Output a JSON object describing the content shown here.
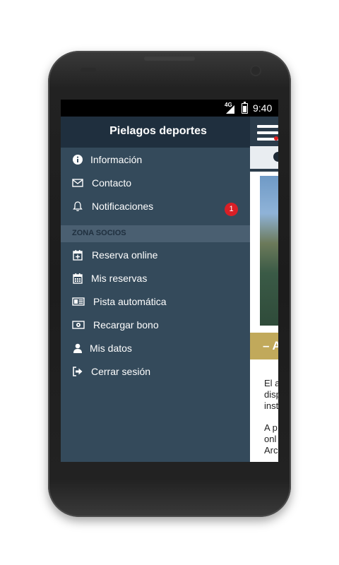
{
  "status_bar": {
    "network": "4G",
    "time": "9:40"
  },
  "drawer": {
    "title": "Pielagos deportes",
    "items": [
      {
        "label": "Información",
        "icon": "info-icon"
      },
      {
        "label": "Contacto",
        "icon": "envelope-icon"
      },
      {
        "label": "Notificaciones",
        "icon": "bell-icon",
        "badge": "1"
      }
    ],
    "section_label": "ZONA SOCIOS",
    "socios_items": [
      {
        "label": "Reserva online",
        "icon": "calendar-plus-icon"
      },
      {
        "label": "Mis reservas",
        "icon": "calendar-icon"
      },
      {
        "label": "Pista automática",
        "icon": "newspaper-icon"
      },
      {
        "label": "Recargar bono",
        "icon": "money-icon"
      },
      {
        "label": "Mis datos",
        "icon": "user-icon"
      },
      {
        "label": "Cerrar sesión",
        "icon": "sign-out-icon"
      }
    ]
  },
  "background": {
    "banner_text": "– A",
    "body_lines": [
      "El a",
      "disp",
      "inst",
      "A p",
      "onl",
      "Arc"
    ]
  },
  "colors": {
    "drawer_bg": "#344a5b",
    "drawer_header_bg": "#1f2f3e",
    "section_bg": "#4a5f71",
    "badge": "#d91f26",
    "banner": "#c1a95b"
  }
}
